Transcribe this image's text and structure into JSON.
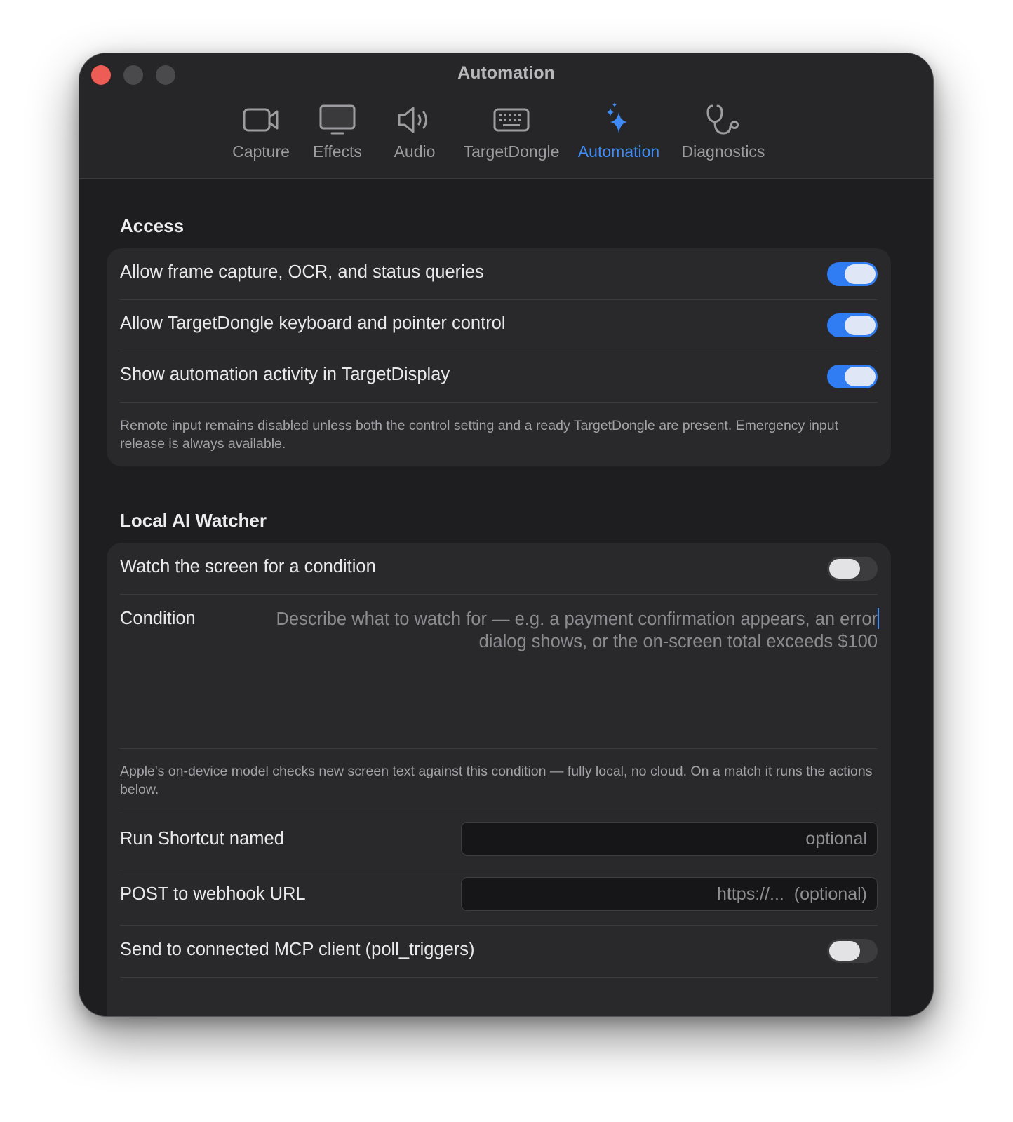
{
  "window": {
    "title": "Automation"
  },
  "toolbar": {
    "tabs": [
      {
        "label": "Capture",
        "icon": "video-camera-icon"
      },
      {
        "label": "Effects",
        "icon": "display-icon"
      },
      {
        "label": "Audio",
        "icon": "speaker-icon"
      },
      {
        "label": "TargetDongle",
        "icon": "keyboard-icon"
      },
      {
        "label": "Automation",
        "icon": "sparkles-icon",
        "active": true
      },
      {
        "label": "Diagnostics",
        "icon": "stethoscope-icon"
      }
    ]
  },
  "access": {
    "title": "Access",
    "rows": [
      {
        "label": "Allow frame capture, OCR, and status queries",
        "on": true
      },
      {
        "label": "Allow TargetDongle keyboard and pointer control",
        "on": true
      },
      {
        "label": "Show automation activity in TargetDisplay",
        "on": true
      }
    ],
    "footnote": "Remote input remains disabled unless both the control setting and a ready TargetDongle are present. Emergency input release is always available."
  },
  "watcher": {
    "title": "Local AI Watcher",
    "watch_label": "Watch the screen for a condition",
    "watch_on": false,
    "condition_label": "Condition",
    "condition_placeholder": "Describe what to watch for — e.g. a payment confirmation appears, an error dialog shows, or the on-screen total exceeds $100",
    "footnote": "Apple's on-device model checks new screen text against this condition — fully local, no cloud. On a match it runs the actions below.",
    "shortcut_label": "Run Shortcut named",
    "shortcut_placeholder": "optional",
    "webhook_label": "POST to webhook URL",
    "webhook_placeholder": "https://...  (optional)",
    "mcp_label": "Send to connected MCP client (poll_triggers)",
    "mcp_on": false
  },
  "colors": {
    "accent": "#3f8cf6",
    "toggle_on": "#2f7cf3",
    "close": "#ee5d55",
    "window_bg": "#1e1e20",
    "card_bg": "#29292c"
  }
}
